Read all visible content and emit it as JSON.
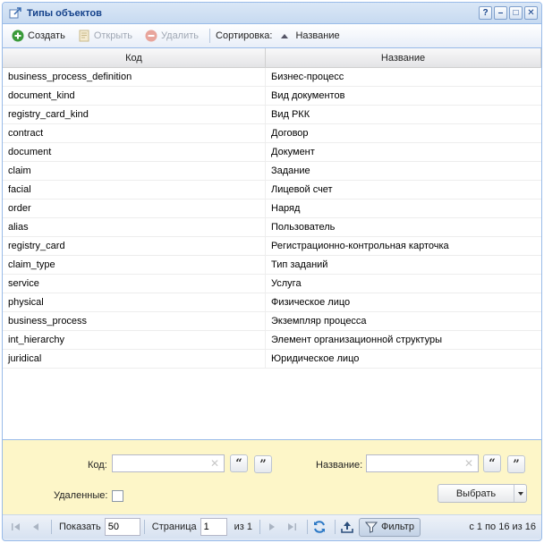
{
  "window": {
    "title": "Типы объектов",
    "tools": [
      "?",
      "–",
      "□",
      "✕"
    ]
  },
  "toolbar": {
    "create_label": "Создать",
    "open_label": "Открыть",
    "delete_label": "Удалить",
    "sort_label": "Сортировка:",
    "sort_field": "Название"
  },
  "grid": {
    "columns": [
      "Код",
      "Название"
    ],
    "rows": [
      [
        "business_process_definition",
        "Бизнес-процесс"
      ],
      [
        "document_kind",
        "Вид документов"
      ],
      [
        "registry_card_kind",
        "Вид РКК"
      ],
      [
        "contract",
        "Договор"
      ],
      [
        "document",
        "Документ"
      ],
      [
        "claim",
        "Задание"
      ],
      [
        "facial",
        "Лицевой счет"
      ],
      [
        "order",
        "Наряд"
      ],
      [
        "alias",
        "Пользователь"
      ],
      [
        "registry_card",
        "Регистрационно-контрольная карточка"
      ],
      [
        "claim_type",
        "Тип заданий"
      ],
      [
        "service",
        "Услуга"
      ],
      [
        "physical",
        "Физическое лицо"
      ],
      [
        "business_process",
        "Экземпляр процесса"
      ],
      [
        "int_hierarchy",
        "Элемент организационной структуры"
      ],
      [
        "juridical",
        "Юридическое лицо"
      ]
    ]
  },
  "filter": {
    "code_label": "Код:",
    "code_value": "",
    "name_label": "Название:",
    "name_value": "",
    "deleted_label": "Удаленные:",
    "deleted_checked": false,
    "select_label": "Выбрать",
    "quote_open": "“",
    "quote_close": "”"
  },
  "pager": {
    "show_label": "Показать",
    "page_size": "50",
    "page_label": "Страница",
    "page_value": "1",
    "of_label": "из 1",
    "filter_label": "Фильтр",
    "info": "с 1 по 16 из 16"
  },
  "colors": {
    "accent": "#15428b",
    "create_green": "#3a9a3a",
    "delete_red": "#e05a4a",
    "filter_bg": "#fdf6c8"
  }
}
